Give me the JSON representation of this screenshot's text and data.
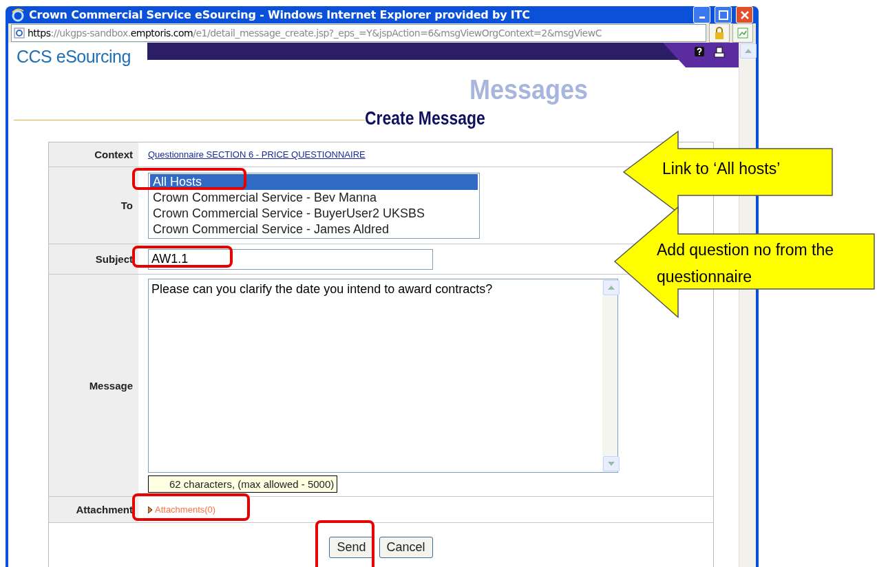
{
  "window": {
    "title": "Crown Commercial Service eSourcing - Windows Internet Explorer provided by ITC"
  },
  "address_bar": {
    "url_parts": [
      {
        "text": "https",
        "strong": true
      },
      {
        "text": "://ukgps-sandbox.",
        "strong": false
      },
      {
        "text": "emptoris.com",
        "strong": true
      },
      {
        "text": "/e1/detail_message_create.jsp?_eps_=Y&jspAction=6&msgViewOrgContext=2&msgViewC",
        "strong": false
      }
    ]
  },
  "header": {
    "brand": "CCS eSourcing"
  },
  "page": {
    "section": "Messages",
    "title": "Create Message"
  },
  "form": {
    "context": {
      "label": "Context",
      "link": "Questionnaire SECTION 6 - PRICE QUESTIONNAIRE"
    },
    "to": {
      "label": "To",
      "options": [
        {
          "text": "All Hosts",
          "selected": true
        },
        {
          "text": "Crown Commercial Service - Bev Manna",
          "selected": false
        },
        {
          "text": "Crown Commercial Service - BuyerUser2 UKSBS",
          "selected": false
        },
        {
          "text": "Crown Commercial Service - James Aldred",
          "selected": false
        }
      ]
    },
    "subject": {
      "label": "Subject",
      "value": "AW1.1"
    },
    "message": {
      "label": "Message",
      "value": "Please can you clarify the date you intend to award contracts?",
      "counter": "62 characters, (max allowed - 5000)"
    },
    "attachment": {
      "label": "Attachment",
      "link": "Attachments(0)"
    }
  },
  "buttons": [
    "Send",
    "Cancel"
  ],
  "callouts": [
    "Link to ‘All hosts’",
    "Add question no from the questionnaire"
  ]
}
